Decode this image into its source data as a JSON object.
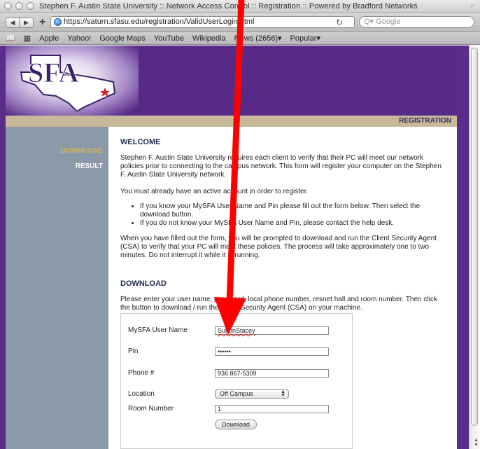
{
  "browser": {
    "window_title": "Stephen F. Austin State University :: Network Access Control :: Registration :: Powered by Bradford Networks",
    "url": "https://saturn.sfasu.edu/registration/ValidUserLogin.html",
    "search_placeholder": "Google",
    "bookmarks": [
      "Apple",
      "Yahoo!",
      "Google Maps",
      "YouTube",
      "Wikipedia",
      "News (2656)▾",
      "Popular▾"
    ]
  },
  "site": {
    "logo_text": "SFA",
    "section_bar": "REGISTRATION",
    "sidebar": {
      "download": "DOWNLOAD",
      "result": "RESULT"
    },
    "welcome": {
      "title": "WELCOME",
      "p1": "Stephen F. Austin State University requires each client to verify that their PC will meet our network policies prior to connecting to the campus network. This form will register your computer on the Stephen F. Austin State University network.",
      "p2": "You must already have an active account in order to register.",
      "bullet1": "If you know your MySFA User Name and Pin please fill out the form below. Then select the download button.",
      "bullet2": "If you do not know your MySFA User Name and Pin, please contact the help desk.",
      "p3": "When you have filled out the form, you will be prompted to download and run the Client Security Agent (CSA) to verify that your PC will meet these policies. The process will take approximately one to two minutes. Do not interrupt it while it is running."
    },
    "download": {
      "title": "DOWNLOAD",
      "p1": "Please enter your user name, password, local phone number, resnet hall and room number. Then click the button to download / run the Client Security Agent (CSA) on your machine."
    },
    "form": {
      "username_label": "MySFA User Name",
      "username_value": "SuttonStacey",
      "pin_label": "Pin",
      "pin_value": "••••••",
      "phone_label": "Phone #",
      "phone_value": "936 867-5309",
      "location_label": "Location",
      "location_value": "Off Campus",
      "room_label": "Room Number",
      "room_value": "1",
      "button_label": "Download"
    }
  },
  "colors": {
    "purple": "#562a86",
    "arrow": "#ff0000"
  }
}
